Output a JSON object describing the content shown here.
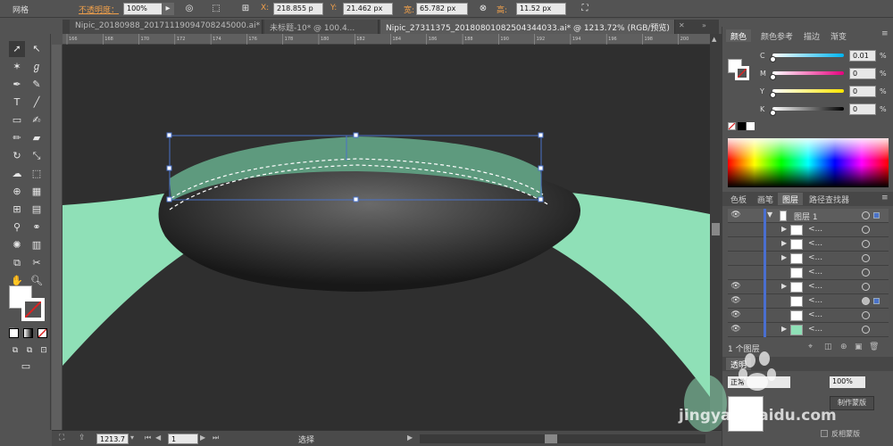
{
  "control_bar": {
    "panel_label": "网格",
    "opacity_label": "不透明度：",
    "opacity_value": "100%",
    "x_label": "X:",
    "x_value": "218.855 p",
    "y_label": "Y:",
    "y_value": "21.462 px",
    "width_label": "宽:",
    "width_value": "65.782 px",
    "height_label": "高:",
    "height_value": "11.52 px"
  },
  "tabs": [
    {
      "label": "Nipic_20180988_20171119094708245000.ai*"
    },
    {
      "label": "未标题-10* @ 100.4..."
    },
    {
      "label": "Nipic_27311375_20180801082504344033.ai* @ 1213.72% (RGB/预览)"
    }
  ],
  "ruler_ticks": [
    "166",
    "168",
    "170",
    "172",
    "174",
    "176",
    "178",
    "180",
    "182",
    "184",
    "186",
    "188",
    "190",
    "192",
    "194",
    "196",
    "198",
    "200"
  ],
  "status": {
    "zoom": "1213.7",
    "page": "1",
    "tool": "选择"
  },
  "color_panel": {
    "tabs": [
      "颜色",
      "颜色参考",
      "描边",
      "渐变"
    ],
    "channels": [
      {
        "label": "C",
        "value": "0.01",
        "unit": "%"
      },
      {
        "label": "M",
        "value": "0",
        "unit": "%"
      },
      {
        "label": "Y",
        "value": "0",
        "unit": "%"
      },
      {
        "label": "K",
        "value": "0",
        "unit": "%"
      }
    ]
  },
  "layers_panel": {
    "tabs": [
      "色板",
      "画笔",
      "图层",
      "路径查找器"
    ],
    "layer_name": "图层 1",
    "sublayer_label": "<...",
    "count_text": "1 个图层"
  },
  "transparency_panel": {
    "tab": "透明",
    "mode": "正常",
    "opacity": "100%",
    "make_mask": "制作蒙版",
    "invert_mask": "反相蒙版"
  },
  "watermark": {
    "text": "jingyan.baidu.com"
  },
  "colors": {
    "canvas": "#2f2f2f",
    "mint": "#8fe0b7",
    "selection": "#4a72c8"
  }
}
